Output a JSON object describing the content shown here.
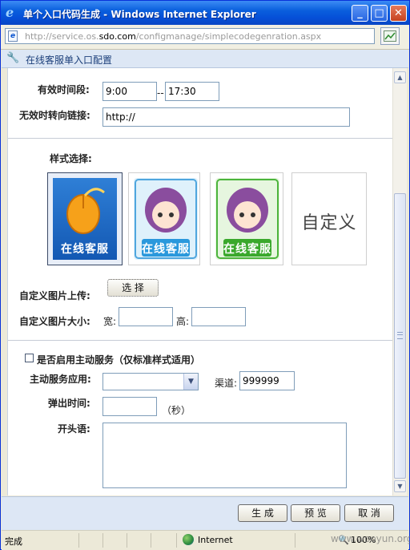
{
  "window": {
    "title": "单个入口代码生成 - Windows Internet Explorer",
    "minimize_glyph": "_",
    "maximize_glyph": "□",
    "close_glyph": "✕"
  },
  "address": {
    "url_prefix": "http://service.os.",
    "url_domain": "sdo.com",
    "url_path": "/configmanage/simplecodegenration.aspx"
  },
  "page": {
    "title": "在线客服单入口配置"
  },
  "form": {
    "partial_top_label": "",
    "time_range_label": "有效时间段:",
    "time_start": "9:00",
    "time_sep": "--",
    "time_end": "17:30",
    "invalid_link_label": "无效时转向链接:",
    "invalid_link_value": "http://",
    "style_label": "样式选择:",
    "styles": [
      {
        "caption": "在线客服"
      },
      {
        "caption": "在线客服"
      },
      {
        "caption": "在线客服"
      },
      {
        "caption": "自定义"
      }
    ],
    "upload_label": "自定义图片上传:",
    "upload_button": "选 择",
    "size_label": "自定义图片大小:",
    "width_label": "宽:",
    "height_label": "高:",
    "active_service_label": "是否启用主动服务（仅标准样式适用）",
    "app_label": "主动服务应用:",
    "channel_label": "渠道:",
    "channel_value": "999999",
    "popup_label": "弹出时间:",
    "popup_unit": "（秒）",
    "greeting_label": "开头语:"
  },
  "footer": {
    "generate": "生 成",
    "preview": "预 览",
    "cancel": "取 消"
  },
  "status": {
    "left": "完成",
    "zone": "Internet",
    "zoom": "100%"
  },
  "watermark": "www.wooyun.org",
  "colors": {
    "title_bar": "#0a5fdd",
    "page_header": "#dde7f5"
  }
}
